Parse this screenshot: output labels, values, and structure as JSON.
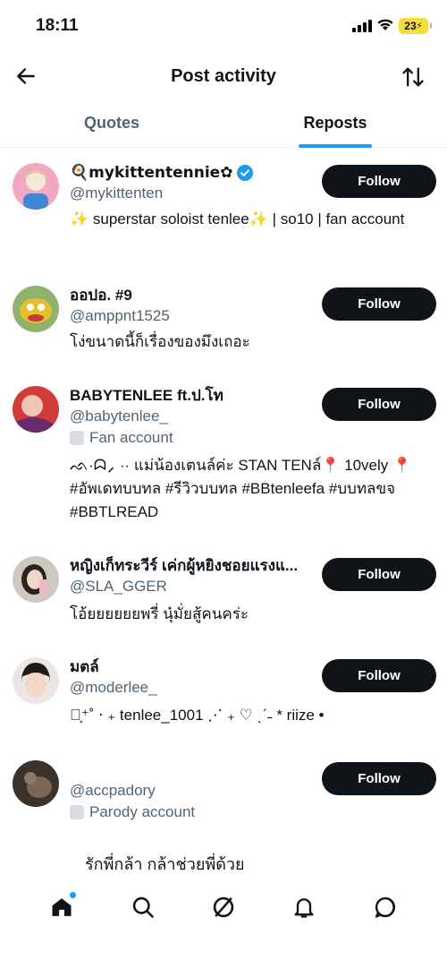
{
  "status_bar": {
    "time": "18:11",
    "battery": "23"
  },
  "header": {
    "title": "Post activity"
  },
  "tabs": [
    {
      "label": "Quotes"
    },
    {
      "label": "Reposts"
    }
  ],
  "users": [
    {
      "name": "🍳𝗺𝘆𝗸𝗶𝘁𝘁𝗲𝗻𝘁𝗲𝗻𝗻𝗶𝗲✿",
      "handle": "@mykittenten",
      "label": "",
      "bio": "✨ superstar soloist tenlee✨ | so10 | fan account",
      "follow": "Follow"
    },
    {
      "name": "ออปอ. #9",
      "handle": "@amppnt1525",
      "label": "",
      "bio": "โง่ขนาดนี้ก็เรื่องของมึงเถอะ",
      "follow": "Follow"
    },
    {
      "name": "BABYTENLEE ft.ป.โท",
      "handle": "@babytenlee_",
      "label": "Fan account",
      "bio": "ᨒ·ᗣ⸝ ·· แม่น้องเตนล์ค่ะ STAN TENล์📍 10vely 📍 #อัพเดทบบทล #รีวิวบบทล #BBtenleefa #บบทลขจ #BBTLREAD",
      "follow": "Follow"
    },
    {
      "name": "หญิงเก็ทระวีร์ เค่กผู้หยิงชอยแรงแ...",
      "handle": "@SLA_GGER",
      "label": "",
      "bio": "โอ้ยยยยยยพรี่ นุ๋มั่ยสู้คนคร่ะ",
      "follow": "Follow"
    },
    {
      "name": "มตล์",
      "handle": "@moderlee_",
      "label": "",
      "bio": "‧͙⁺˚ ‧ ₊ tenlee_1001 ⋰ ₊ ♡ ˎˊ˗ * riize •",
      "follow": "Follow"
    },
    {
      "name": "ํ",
      "handle": "@accpadory",
      "label": "Parody account",
      "bio": "",
      "follow": "Follow"
    }
  ],
  "partial_text": "รักพี่กล้า กล้าช่วยพี่ด้วย",
  "nav": [
    "home-icon",
    "search-icon",
    "grok-icon",
    "notifications-icon",
    "messages-icon"
  ],
  "colors": {
    "accent": "#1d9bf0",
    "button": "#0f1419",
    "secondary": "#536471"
  }
}
